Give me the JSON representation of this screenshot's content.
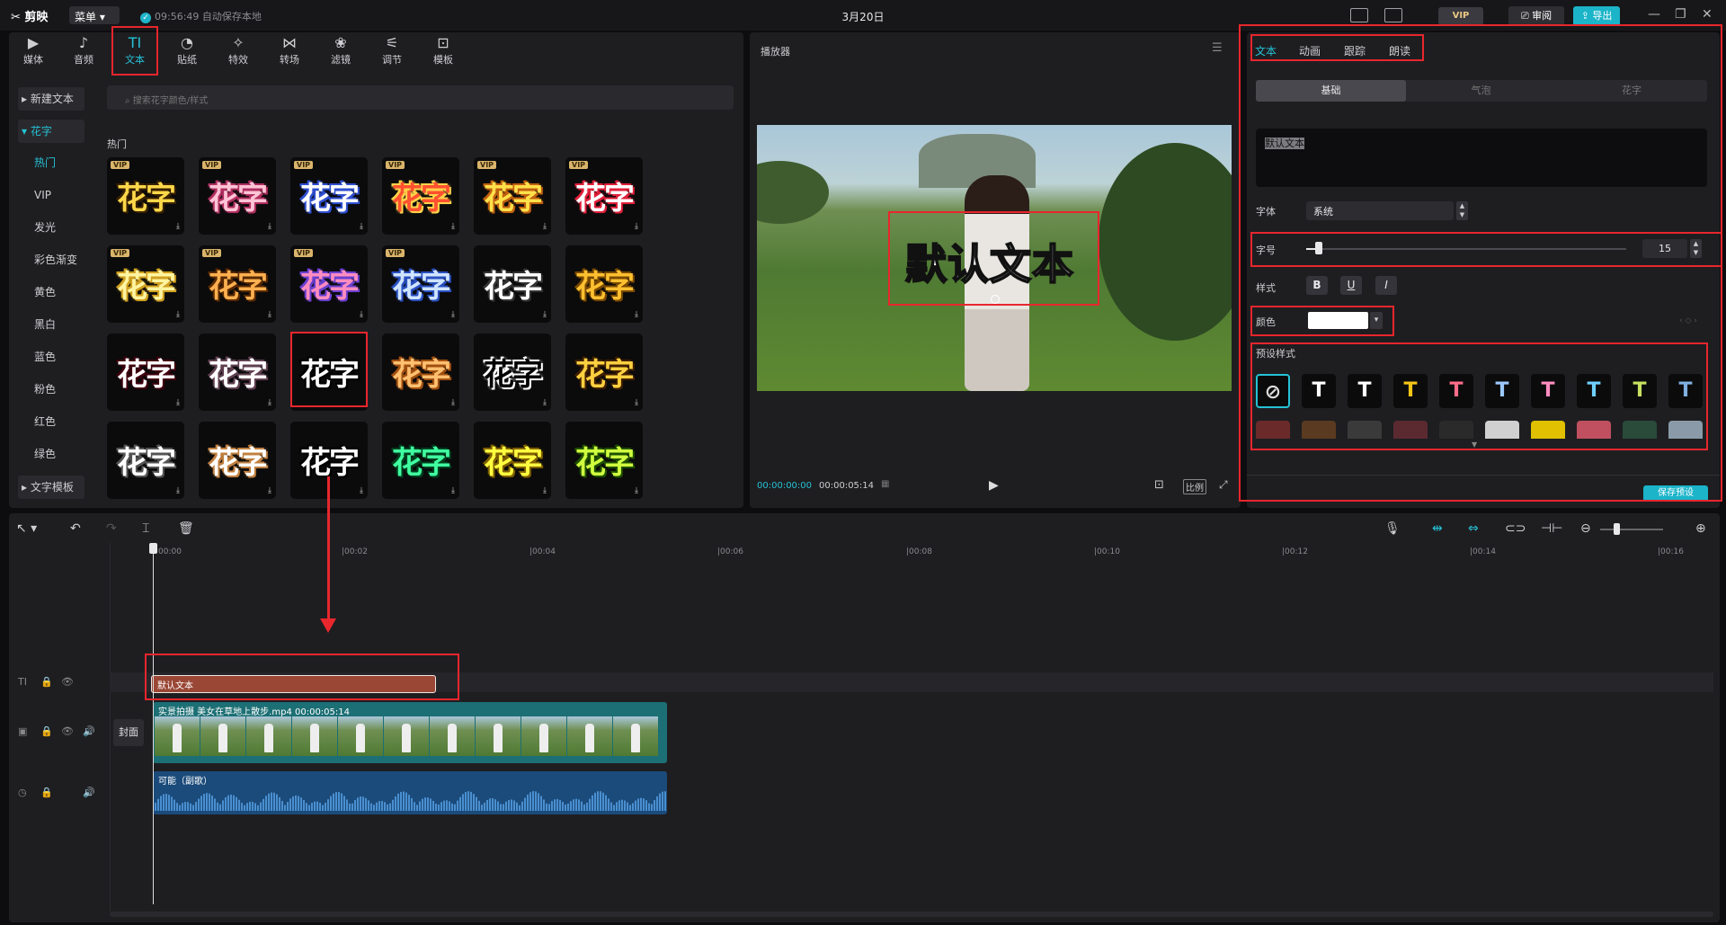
{
  "titlebar": {
    "logo": "✂ 剪映",
    "menu": "菜单",
    "autosave": "09:56:49 自动保存本地",
    "title": "3月20日",
    "vip": "VIP",
    "review": "审阅",
    "export": "导出",
    "win_min": "—",
    "win_max": "❐",
    "win_close": "✕"
  },
  "media_tabs": [
    {
      "label": "媒体",
      "icon": "▶"
    },
    {
      "label": "音频",
      "icon": "♪"
    },
    {
      "label": "文本",
      "icon": "TI"
    },
    {
      "label": "贴纸",
      "icon": "◔"
    },
    {
      "label": "特效",
      "icon": "✧"
    },
    {
      "label": "转场",
      "icon": "⋈"
    },
    {
      "label": "滤镜",
      "icon": "❀"
    },
    {
      "label": "调节",
      "icon": "⚟"
    },
    {
      "label": "模板",
      "icon": "⊡"
    }
  ],
  "sidebar": {
    "new_text": "新建文本",
    "huazi": "花字",
    "items": [
      "热门",
      "VIP",
      "发光",
      "彩色渐变",
      "黄色",
      "黑白",
      "蓝色",
      "粉色",
      "红色",
      "绿色"
    ],
    "text_template": "文字模板"
  },
  "search": {
    "placeholder": "搜索花字颜色/样式"
  },
  "hot_label": "热门",
  "fx_glyph": "花字",
  "fx_vip": "VIP",
  "fx_download": "⤓",
  "player": {
    "title": "播放器",
    "overlay_text": "默认文本",
    "time_current": "00:00:00:00",
    "time_total": "00:00:05:14",
    "ratio": "比例",
    "play": "▶"
  },
  "right_panel": {
    "tabs": [
      "文本",
      "动画",
      "跟踪",
      "朗读"
    ],
    "segments": [
      "基础",
      "气泡",
      "花字"
    ],
    "text_value": "默认文本",
    "font_label": "字体",
    "font_value": "系统",
    "size_label": "字号",
    "size_value": "15",
    "size_level": 0.04,
    "style_label": "样式",
    "style_bold": "B",
    "style_underline": "U",
    "style_italic": "I",
    "color_label": "颜色",
    "color_value": "#ffffff",
    "preset_label": "预设样式",
    "save_preset": "保存预设"
  },
  "timeline": {
    "ruler": [
      "00:00",
      "|00:02",
      "|00:04",
      "|00:06",
      "|00:08",
      "|00:10",
      "|00:12",
      "|00:14",
      "|00:16"
    ],
    "text_clip": "默认文本",
    "video_clip": "实景拍摄 美女在草地上散步.mp4  00:00:05:14",
    "audio_clip": "可能（副歌）",
    "cover": "封面"
  },
  "colors": {
    "accent": "#25c2d6",
    "highlight_box": "#e8262d",
    "text_clip": "#9a4735",
    "video_clip": "#1c6f74",
    "audio_clip": "#1b4b7b"
  },
  "icons": [
    "check-icon",
    "keyboard-icon",
    "layout-icon",
    "review-icon",
    "export-icon",
    "select-icon",
    "undo-icon",
    "redo-icon",
    "split-icon",
    "delete-icon",
    "mic-icon",
    "zoom-icon",
    "lock-icon",
    "eye-icon",
    "volume-icon"
  ]
}
